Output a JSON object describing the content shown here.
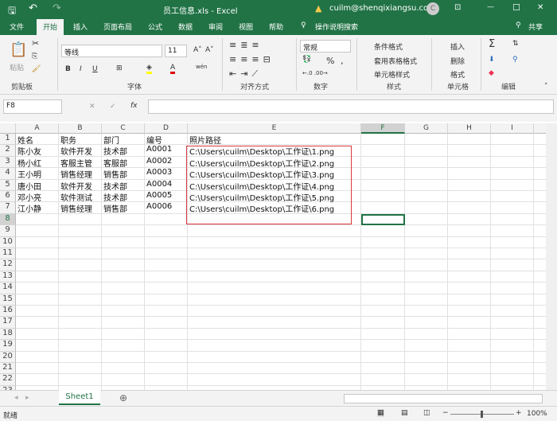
{
  "titlebar": {
    "title": "员工信息.xls  -  Excel",
    "user": "cuilm@shenqixiangsu.com",
    "avatar": "C",
    "minimize": "—",
    "maximize": "☐",
    "close": "✕",
    "save_icon": "save-icon",
    "undo": "↶",
    "redo": "↷"
  },
  "ribbon_tabs": [
    "文件",
    "开始",
    "插入",
    "页面布局",
    "公式",
    "数据",
    "审阅",
    "视图",
    "帮助"
  ],
  "search_label": "操作说明搜索",
  "share_label": "共享",
  "ribbon": {
    "paste": "粘贴",
    "clipboard": "剪贴板",
    "font_name": "等线",
    "font_size": "11",
    "font": "字体",
    "bold": "B",
    "italic": "I",
    "underline": "U",
    "align": "对齐方式",
    "number_format": "常规",
    "number": "数字",
    "cond_format": "条件格式",
    "table_format": "套用表格格式",
    "cell_style": "单元格样式",
    "styles": "样式",
    "insert": "插入",
    "delete": "删除",
    "format": "格式",
    "cells": "单元格",
    "editing": "编辑",
    "percent": "%",
    "comma": ","
  },
  "formula_bar": {
    "name_box": "F8",
    "fx": "fx",
    "cancel": "✕",
    "enter": "✓",
    "value": ""
  },
  "columns": [
    "A",
    "B",
    "C",
    "D",
    "E",
    "F",
    "G",
    "H",
    "I"
  ],
  "rows": [
    [
      "姓名",
      "职务",
      "部门",
      "编号",
      "照片路径"
    ],
    [
      "陈小友",
      "软件开发",
      "技术部",
      "A0001",
      "C:\\Users\\cuilm\\Desktop\\工作证\\1.png"
    ],
    [
      "杨小红",
      "客服主管",
      "客服部",
      "A0002",
      "C:\\Users\\cuilm\\Desktop\\工作证\\2.png"
    ],
    [
      "王小明",
      "销售经理",
      "销售部",
      "A0003",
      "C:\\Users\\cuilm\\Desktop\\工作证\\3.png"
    ],
    [
      "唐小田",
      "软件开发",
      "技术部",
      "A0004",
      "C:\\Users\\cuilm\\Desktop\\工作证\\4.png"
    ],
    [
      "邓小亮",
      "软件测试",
      "技术部",
      "A0005",
      "C:\\Users\\cuilm\\Desktop\\工作证\\5.png"
    ],
    [
      "江小静",
      "销售经理",
      "销售部",
      "A0006",
      "C:\\Users\\cuilm\\Desktop\\工作证\\6.png"
    ]
  ],
  "row_count": 23,
  "selected_cell": "F8",
  "sheet_tab": "Sheet1",
  "status": {
    "ready": "就绪",
    "zoom": "100%"
  },
  "colors": {
    "accent": "#217346",
    "highlight_box": "#d9383a"
  }
}
